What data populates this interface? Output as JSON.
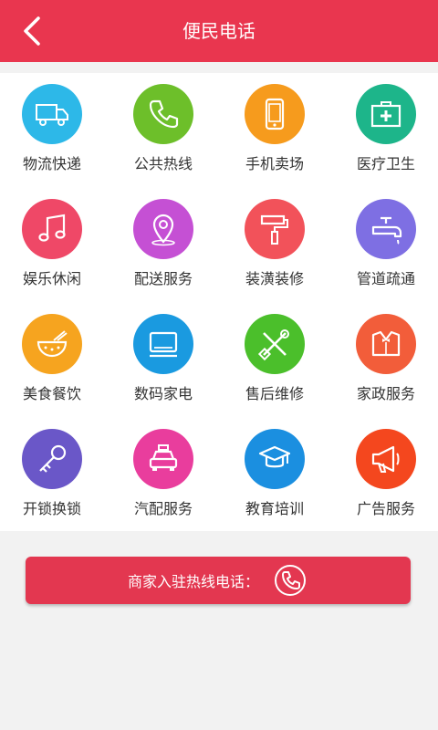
{
  "header": {
    "title": "便民电话"
  },
  "items": [
    {
      "label": "物流快递",
      "color": "#2db8e8",
      "icon": "truck-icon"
    },
    {
      "label": "公共热线",
      "color": "#6dbf2a",
      "icon": "phone-icon"
    },
    {
      "label": "手机卖场",
      "color": "#f69b1d",
      "icon": "mobile-icon"
    },
    {
      "label": "医疗卫生",
      "color": "#1db58a",
      "icon": "medical-kit-icon"
    },
    {
      "label": "娱乐休闲",
      "color": "#ef4867",
      "icon": "music-note-icon"
    },
    {
      "label": "配送服务",
      "color": "#c550d4",
      "icon": "map-pin-icon"
    },
    {
      "label": "装潢装修",
      "color": "#f2525a",
      "icon": "paint-roller-icon"
    },
    {
      "label": "管道疏通",
      "color": "#7e6fe3",
      "icon": "faucet-icon"
    },
    {
      "label": "美食餐饮",
      "color": "#f6a41f",
      "icon": "food-bowl-icon"
    },
    {
      "label": "数码家电",
      "color": "#1a9ae0",
      "icon": "appliance-icon"
    },
    {
      "label": "售后维修",
      "color": "#4bbf2b",
      "icon": "tools-icon"
    },
    {
      "label": "家政服务",
      "color": "#f25d3a",
      "icon": "tuxedo-icon"
    },
    {
      "label": "开锁换锁",
      "color": "#6a57c8",
      "icon": "key-icon"
    },
    {
      "label": "汽配服务",
      "color": "#e93d9d",
      "icon": "taxi-icon"
    },
    {
      "label": "教育培训",
      "color": "#1b8fe0",
      "icon": "graduation-cap-icon"
    },
    {
      "label": "广告服务",
      "color": "#f4471e",
      "icon": "megaphone-icon"
    }
  ],
  "hotline": {
    "label": "商家入驻热线电话："
  }
}
